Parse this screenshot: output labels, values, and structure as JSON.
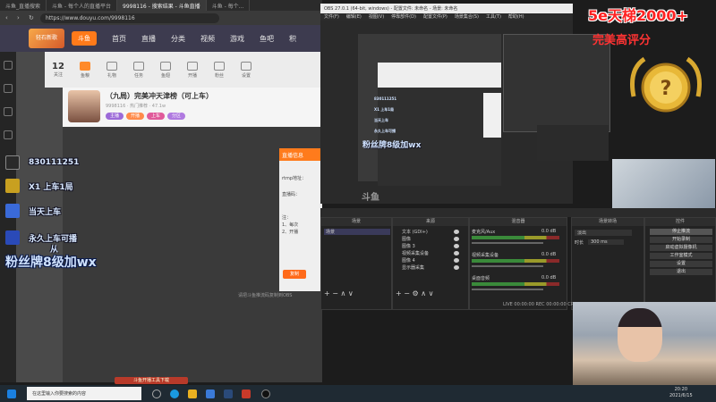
{
  "browser": {
    "tabs": [
      "斗鱼_直播搜索",
      "斗鱼 - 每个人的直播平台",
      "9998116 - 搜索结果 - 斗鱼直播",
      "斗鱼 - 每个..."
    ],
    "url": "https://www.douyu.com/9998116"
  },
  "douyu": {
    "logo_text": "轻石新歌",
    "logo2_text": "斗鱼",
    "nav": [
      "首页",
      "直播",
      "分类",
      "视频",
      "游戏",
      "鱼吧",
      "积"
    ],
    "tools": [
      {
        "num": "12",
        "label": "关注"
      },
      {
        "num": "",
        "label": "鱼粮"
      },
      {
        "num": "",
        "label": "礼物"
      },
      {
        "num": "",
        "label": "任务"
      },
      {
        "num": "",
        "label": "鱼翅"
      },
      {
        "num": "",
        "label": "开播"
      },
      {
        "num": "",
        "label": "粉丝"
      },
      {
        "num": "",
        "label": "设置"
      }
    ],
    "room_title": "（九局）完美冲天津榜（可上车）",
    "room_meta": "9998116 · 热门推荐 · 47.1w",
    "tags": [
      "主播",
      "开播",
      "上车",
      "分区"
    ],
    "modal_title": "直播信息",
    "modal_lines": [
      "rtmp地址：",
      "直播码：",
      "注：",
      "1、每次",
      "2、开播"
    ],
    "modal_btn": "复制",
    "bottom_text": "请把斗鱼推流码复制到OBS",
    "red_btn": "斗鱼开播工具下载"
  },
  "overlay": {
    "rows": [
      {
        "text": "830111251",
        "icon_color": "#2a2a2a"
      },
      {
        "text": "X1 上车1局",
        "icon_color": "#c8a020"
      },
      {
        "text": "当天上车",
        "icon_color": "#3a6ad8"
      },
      {
        "text": "永久上车可播",
        "icon_color": "#2a4ab8"
      }
    ],
    "from": "从",
    "fans": "粉丝牌8级加wx",
    "rank": "5e天梯2000+",
    "rank_sub": "完美高评分"
  },
  "taskbar": {
    "search": "在这里输入你要搜索的内容",
    "time": "20:20",
    "date": "2021/6/15"
  },
  "obs": {
    "title": "OBS 27.0.1 (64-bit, windows) - 配置文件: 未命名 - 场景: 未命名",
    "menu": [
      "文件(F)",
      "编辑(E)",
      "视图(V)",
      "停靠部件(D)",
      "配置文件(P)",
      "场景集合(S)",
      "工具(T)",
      "帮助(H)"
    ],
    "docks": {
      "scenes": "场景",
      "scene_item": "场景",
      "sources": "来源",
      "source_items": [
        "文本 (GDI+)",
        "图像",
        "图像 3",
        "视频采集设备",
        "图像 4",
        "显示器采集"
      ],
      "mixer": "混音器",
      "mixer_items": [
        {
          "name": "麦克风/Aux",
          "db": "0.0 dB"
        },
        {
          "name": "视频采集设备",
          "db": "0.0 dB"
        },
        {
          "name": "桌面音频",
          "db": "0.0 dB"
        }
      ],
      "transition": "场景转场",
      "transition_type": "淡出",
      "duration_label": "时长",
      "duration": "300 ms",
      "controls": "控件",
      "control_buttons": [
        "停止推流",
        "开始录制",
        "启动虚拟摄像机",
        "工作室模式",
        "设置",
        "退出"
      ]
    },
    "status": "LIVE 00:00:00   REC 00:00:00   CPU: 2.1%, 60.00 fps",
    "preview_small_fans": "粉丝牌8级加wx",
    "preview_small_rows": [
      "830111251",
      "X1 上车1局",
      "当天上车",
      "永久上车可播"
    ],
    "preview_logo": "斗鱼"
  },
  "colors": {
    "douyu_orange": "#ff7b1c",
    "obs_bg": "#232323",
    "overlay_red": "#ff2222"
  }
}
